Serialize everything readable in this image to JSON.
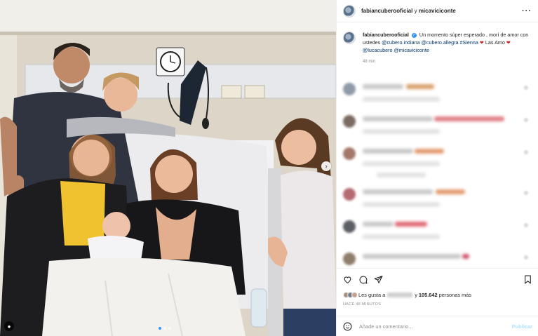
{
  "header": {
    "user_main": "fabiancuberooficial",
    "separator": " y ",
    "user_collab": "micaviciconte",
    "more_icon": "more-horizontal-icon"
  },
  "caption": {
    "user": "fabiancuberooficial",
    "text_1": " Un momento súper esperado , morí de amor con ustedes ",
    "mention_1": "@cubero.indiana",
    "mention_2": "@cubero.allegra",
    "hashtag": "#Sienna",
    "heart_1": "❤",
    "text_2": " Las Amo ",
    "heart_2": "❤",
    "mention_3": "@lucacubero",
    "mention_4": "@micaviciconte",
    "time": "48 min"
  },
  "actions": {
    "like_icon": "heart-icon",
    "comment_icon": "comment-icon",
    "share_icon": "share-icon",
    "save_icon": "bookmark-icon",
    "likes_prefix": "Les gusta a",
    "likes_connector": "y",
    "likes_count": "105.642",
    "likes_suffix": "personas más",
    "post_time": "HACE 48 MINUTOS"
  },
  "add_comment": {
    "emoji_icon": "smiley-icon",
    "placeholder": "Añade un comentario...",
    "publish_label": "Publicar"
  },
  "photo": {
    "next_icon": "chevron-right-icon",
    "tag_icon": "user-tag-icon",
    "carousel_count": 3,
    "carousel_active": 1
  },
  "colors": {
    "link": "#00376b",
    "verified": "#3897f0",
    "publish_disabled": "#b2dffc",
    "heart": "#c62828"
  }
}
